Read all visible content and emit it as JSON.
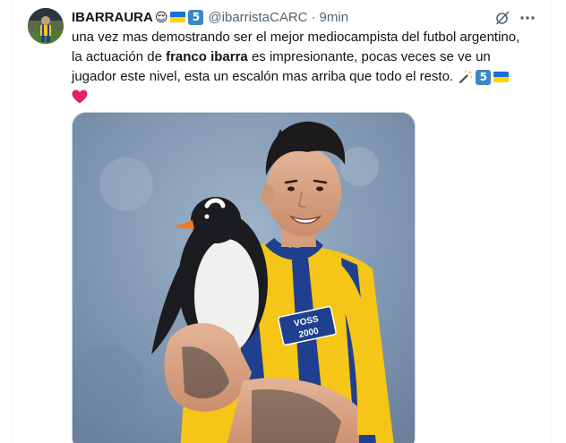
{
  "tweet": {
    "display_name": "IBARRAURA",
    "name_emoji": "😌",
    "name_badge_number": "5",
    "handle": "@ibarristaCARC",
    "separator": "·",
    "time": "9min",
    "text": {
      "line1": "una vez mas demostrando ser el mejor mediocampista del futbol argentino,",
      "line2_pre": "la actuación de ",
      "line2_bold": "franco ibarra",
      "line2_post": " es impresionante, pocas veces se ve un",
      "line3": "jugador este nivel, esta un escalón mas arriba que todo el resto. ",
      "line3_badge_number": "5",
      "line4_emoji": "heart"
    },
    "media": {
      "jersey_text_1": "VOSS",
      "jersey_text_2": "2000"
    }
  },
  "icons": {
    "grok": "grok-icon",
    "more": "more-icon",
    "flag": "ukraine-flag-icon",
    "wand": "magic-wand-icon",
    "heart": "red-heart-icon"
  },
  "colors": {
    "text_primary": "#0f1419",
    "text_secondary": "#536471",
    "border": "#eff3f4",
    "keycap_blue": "#3b88c3",
    "flag_blue": "#1a6ed8",
    "flag_yellow": "#ffd500",
    "heart_red": "#e0245e",
    "jersey_blue": "#1f3f8f",
    "jersey_yellow": "#f5c518"
  }
}
